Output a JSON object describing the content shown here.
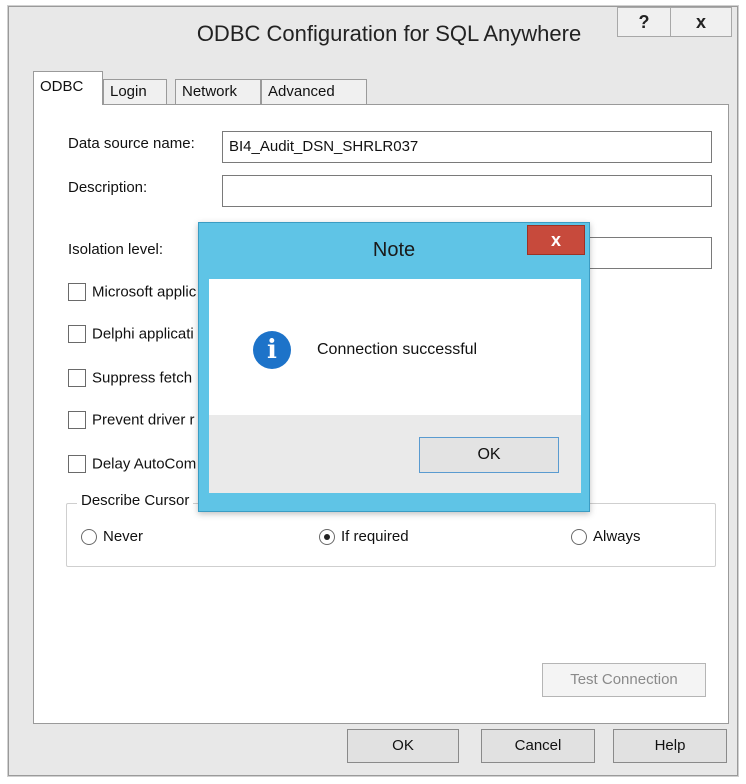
{
  "window": {
    "title": "ODBC Configuration for SQL Anywhere",
    "help_btn": "?",
    "close_btn": "x"
  },
  "tabs": [
    {
      "label": "ODBC",
      "active": true
    },
    {
      "label": "Login",
      "active": false
    },
    {
      "label": "Network",
      "active": false
    },
    {
      "label": "Advanced",
      "active": false
    }
  ],
  "form": {
    "dsn_label": "Data source name:",
    "dsn_value": "BI4_Audit_DSN_SHRLR037",
    "desc_label": "Description:",
    "desc_value": "",
    "isolation_label": "Isolation level:",
    "isolation_value": ""
  },
  "checkboxes": [
    {
      "label": "Microsoft applic",
      "checked": false
    },
    {
      "label": "Delphi applicati",
      "checked": false
    },
    {
      "label": "Suppress fetch",
      "checked": false
    },
    {
      "label": "Prevent driver r",
      "checked": false
    },
    {
      "label": "Delay AutoCom",
      "checked": false
    }
  ],
  "describe_cursor": {
    "title": "Describe Cursor",
    "options": [
      {
        "label": "Never",
        "selected": false
      },
      {
        "label": "If required",
        "selected": true
      },
      {
        "label": "Always",
        "selected": false
      }
    ]
  },
  "test_connection_label": "Test Connection",
  "footer": {
    "ok": "OK",
    "cancel": "Cancel",
    "help": "Help"
  },
  "note": {
    "title": "Note",
    "close": "x",
    "icon": "info-icon",
    "message": "Connection successful",
    "ok": "OK"
  }
}
